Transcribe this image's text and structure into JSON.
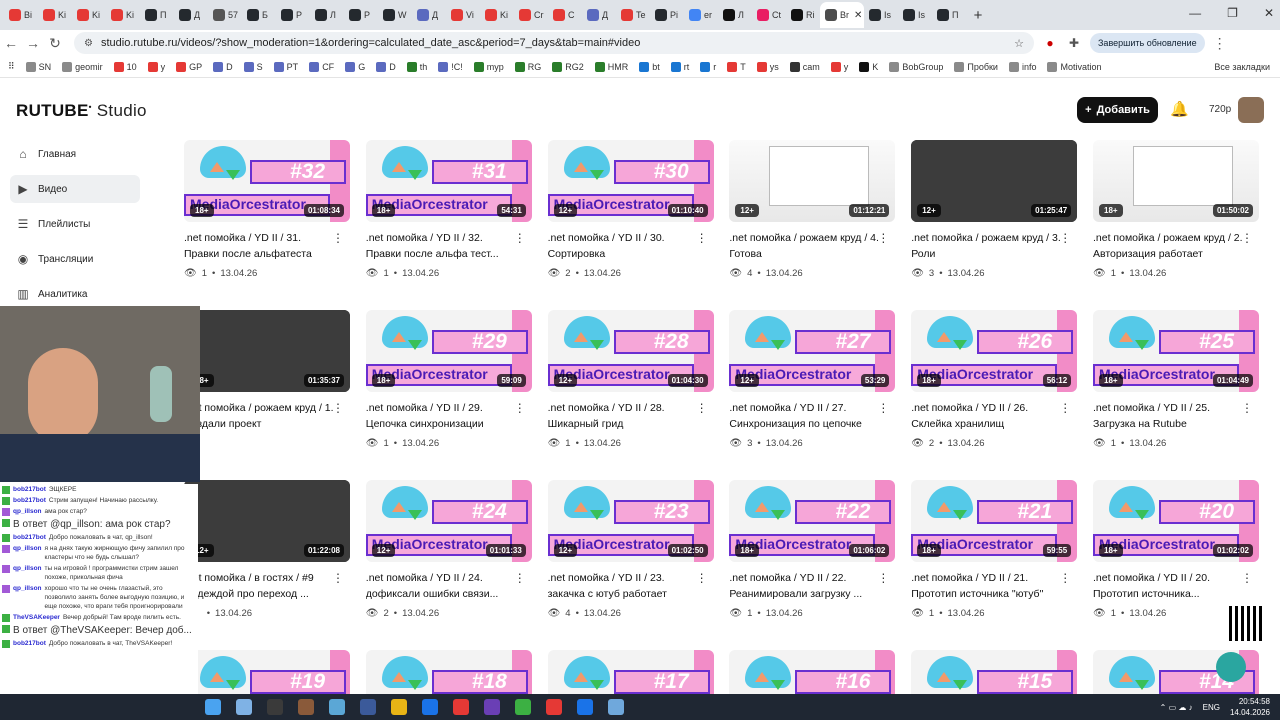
{
  "browser": {
    "tabs": [
      {
        "label": "Bi",
        "color": "#e53935"
      },
      {
        "label": "Ki",
        "color": "#e53935"
      },
      {
        "label": "Ki",
        "color": "#e53935"
      },
      {
        "label": "Ki",
        "color": "#e53935"
      },
      {
        "label": "П",
        "color": "#24292e"
      },
      {
        "label": "Д",
        "color": "#24292e"
      },
      {
        "label": "57",
        "color": "#555555"
      },
      {
        "label": "Б",
        "color": "#24292e"
      },
      {
        "label": "Р",
        "color": "#24292e"
      },
      {
        "label": "Л",
        "color": "#24292e"
      },
      {
        "label": "Р",
        "color": "#24292e"
      },
      {
        "label": "W",
        "color": "#24292e"
      },
      {
        "label": "Д",
        "color": "#5b6abf"
      },
      {
        "label": "Vi",
        "color": "#e53935"
      },
      {
        "label": "Ki",
        "color": "#e53935"
      },
      {
        "label": "Cr",
        "color": "#e53935"
      },
      {
        "label": "С",
        "color": "#e53935"
      },
      {
        "label": "Д",
        "color": "#5b6abf"
      },
      {
        "label": "Te",
        "color": "#e53935"
      },
      {
        "label": "Pi",
        "color": "#24292e"
      },
      {
        "label": "er",
        "color": "#4285f4"
      },
      {
        "label": "Л",
        "color": "#111111"
      },
      {
        "label": "Ct",
        "color": "#e91e63"
      },
      {
        "label": "Ri",
        "color": "#111111"
      },
      {
        "label": "Br",
        "color": "#4d4d4d",
        "active": true
      },
      {
        "label": "Is",
        "color": "#24292e"
      },
      {
        "label": "Is",
        "color": "#24292e"
      },
      {
        "label": "П",
        "color": "#24292e"
      }
    ],
    "url": "studio.rutube.ru/videos/?show_moderation=1&ordering=calculated_date_asc&period=7_days&tab=main#video",
    "update_label": "Завершить обновление",
    "bookmarks": [
      {
        "label": "SN",
        "color": "#8a8a8a"
      },
      {
        "label": "geomir",
        "color": "#8a8a8a"
      },
      {
        "label": "10",
        "color": "#e53935"
      },
      {
        "label": "y",
        "color": "#e53935"
      },
      {
        "label": "GP",
        "color": "#e53935"
      },
      {
        "label": "D",
        "color": "#5b6abf"
      },
      {
        "label": "S",
        "color": "#5b6abf"
      },
      {
        "label": "PT",
        "color": "#5b6abf"
      },
      {
        "label": "CF",
        "color": "#5b6abf"
      },
      {
        "label": "G",
        "color": "#5b6abf"
      },
      {
        "label": "D",
        "color": "#5b6abf"
      },
      {
        "label": "th",
        "color": "#2a7d2a"
      },
      {
        "label": "!C!",
        "color": "#5b6abf"
      },
      {
        "label": "myp",
        "color": "#2a7d2a"
      },
      {
        "label": "RG",
        "color": "#2a7d2a"
      },
      {
        "label": "RG2",
        "color": "#2a7d2a"
      },
      {
        "label": "HMR",
        "color": "#2a7d2a"
      },
      {
        "label": "bt",
        "color": "#1976d2"
      },
      {
        "label": "rt",
        "color": "#1976d2"
      },
      {
        "label": "r",
        "color": "#1976d2"
      },
      {
        "label": "T",
        "color": "#e53935"
      },
      {
        "label": "ys",
        "color": "#e53935"
      },
      {
        "label": "cam",
        "color": "#333333"
      },
      {
        "label": "y",
        "color": "#e53935"
      },
      {
        "label": "K",
        "color": "#111111"
      },
      {
        "label": "BobGroup",
        "color": "#8a8a8a"
      },
      {
        "label": "Пробки",
        "color": "#8a8a8a"
      },
      {
        "label": "info",
        "color": "#8a8a8a"
      },
      {
        "label": "Motivation",
        "color": "#8a8a8a"
      }
    ],
    "all_bookmarks": "Все закладки"
  },
  "header": {
    "logo_main": "RUTUBE",
    "logo_sub": "Studio",
    "add_label": "Добавить",
    "quality": "720p"
  },
  "sidebar": {
    "items": [
      {
        "label": "Главная",
        "icon": "home-icon",
        "glyph": "⌂"
      },
      {
        "label": "Видео",
        "icon": "video-icon",
        "glyph": "▶",
        "active": true
      },
      {
        "label": "Плейлисты",
        "icon": "playlist-icon",
        "glyph": "☰"
      },
      {
        "label": "Трансляции",
        "icon": "broadcast-icon",
        "glyph": "◉"
      },
      {
        "label": "Аналитика",
        "icon": "analytics-icon",
        "glyph": "▥"
      }
    ]
  },
  "videos": [
    {
      "title": ".net помойка / YD II / 31. Правки после альфатеста",
      "views": "1",
      "date": "13.04.26",
      "age": "18+",
      "duration": "01:08:34",
      "thumb": "media",
      "episode": "#32"
    },
    {
      "title": ".net помойка / YD II / 32. Правки после альфа тест...",
      "views": "1",
      "date": "13.04.26",
      "age": "18+",
      "duration": "54:31",
      "thumb": "media",
      "episode": "#31"
    },
    {
      "title": ".net помойка / YD II / 30. Сортировка",
      "views": "2",
      "date": "13.04.26",
      "age": "12+",
      "duration": "01:10:40",
      "thumb": "media",
      "episode": "#30"
    },
    {
      "title": ".net помойка / рожаем круд / 4. Готова",
      "views": "4",
      "date": "13.04.26",
      "age": "12+",
      "duration": "01:12:21",
      "thumb": "screen"
    },
    {
      "title": ".net помойка / рожаем круд / 3. Роли",
      "views": "3",
      "date": "13.04.26",
      "age": "12+",
      "duration": "01:25:47",
      "thumb": "dark"
    },
    {
      "title": ".net помойка / рожаем круд / 2. Авторизация работает",
      "views": "1",
      "date": "13.04.26",
      "age": "18+",
      "duration": "01:50:02",
      "thumb": "screen"
    },
    {
      "title": ".net помойка / рожаем круд / 1. Создали проект",
      "views": "",
      "date": "",
      "age": "18+",
      "duration": "01:35:37",
      "thumb": "dark"
    },
    {
      "title": ".net помойка / YD II / 29. Цепочка синхронизации",
      "views": "1",
      "date": "13.04.26",
      "age": "18+",
      "duration": "59:09",
      "thumb": "media",
      "episode": "#29"
    },
    {
      "title": ".net помойка / YD II / 28. Шикарный грид",
      "views": "1",
      "date": "13.04.26",
      "age": "12+",
      "duration": "01:04:30",
      "thumb": "media",
      "episode": "#28"
    },
    {
      "title": ".net помойка / YD II / 27. Синхронизация по цепочке",
      "views": "3",
      "date": "13.04.26",
      "age": "12+",
      "duration": "53:29",
      "thumb": "media",
      "episode": "#27"
    },
    {
      "title": ".net помойка / YD II / 26. Склейка хранилищ",
      "views": "2",
      "date": "13.04.26",
      "age": "18+",
      "duration": "56:12",
      "thumb": "media",
      "episode": "#26"
    },
    {
      "title": ".net помойка / YD II / 25. Загрузка на Rutube",
      "views": "1",
      "date": "13.04.26",
      "age": "18+",
      "duration": "01:04:49",
      "thumb": "media",
      "episode": "#25"
    },
    {
      "title": ".net помойка / в гостях / #9 Надеждой про переход ...",
      "views": "",
      "date": "13.04.26",
      "age": "12+",
      "duration": "01:22:08",
      "thumb": "dark"
    },
    {
      "title": ".net помойка / YD II / 24. дофиксали ошибки связи...",
      "views": "2",
      "date": "13.04.26",
      "age": "12+",
      "duration": "01:01:33",
      "thumb": "media",
      "episode": "#24"
    },
    {
      "title": ".net помойка / YD II / 23. закачка с ютуб работает",
      "views": "4",
      "date": "13.04.26",
      "age": "12+",
      "duration": "01:02:50",
      "thumb": "media",
      "episode": "#23"
    },
    {
      "title": ".net помойка / YD II / 22. Реанимировали загрузку ...",
      "views": "1",
      "date": "13.04.26",
      "age": "18+",
      "duration": "01:06:02",
      "thumb": "media",
      "episode": "#22"
    },
    {
      "title": ".net помойка / YD II / 21. Прототип источника \"ютуб\"",
      "views": "1",
      "date": "13.04.26",
      "age": "18+",
      "duration": "59:55",
      "thumb": "media",
      "episode": "#21"
    },
    {
      "title": ".net помойка / YD II / 20. Прототип источника...",
      "views": "1",
      "date": "13.04.26",
      "age": "18+",
      "duration": "01:02:02",
      "thumb": "media",
      "episode": "#20"
    },
    {
      "title": "",
      "views": "",
      "date": "",
      "age": "",
      "duration": "",
      "thumb": "media",
      "episode": "#19"
    },
    {
      "title": "",
      "views": "",
      "date": "",
      "age": "",
      "duration": "",
      "thumb": "media",
      "episode": "#18"
    },
    {
      "title": "",
      "views": "",
      "date": "",
      "age": "",
      "duration": "",
      "thumb": "media",
      "episode": "#17"
    },
    {
      "title": "",
      "views": "",
      "date": "",
      "age": "",
      "duration": "",
      "thumb": "media",
      "episode": "#16"
    },
    {
      "title": "",
      "views": "",
      "date": "",
      "age": "",
      "duration": "",
      "thumb": "media",
      "episode": "#15"
    },
    {
      "title": "",
      "views": "",
      "date": "",
      "age": "",
      "duration": "",
      "thumb": "media",
      "episode": "#14"
    }
  ],
  "thumb_brand": "MediaOrcestrator",
  "chat": [
    {
      "user": "bob217bot",
      "text": "ЭЩКЕРЕ"
    },
    {
      "user": "bob217bot",
      "text": "Стрим запущен! Начинаю рассылку."
    },
    {
      "user": "qp_illson",
      "text": "ама рок стар?"
    },
    {
      "user": "",
      "text": "В ответ @qp_illson: ама рок стар?",
      "big": true
    },
    {
      "user": "bob217bot",
      "text": "Добро пожаловать в чат, qp_illson!"
    },
    {
      "user": "qp_illson",
      "text": "я на днях такую жирнющую фичу запилил про кластеры что не будь слышал?"
    },
    {
      "user": "qp_illson",
      "text": "ты на игровой ! программистки стрим зашел похоже, прикольная фича"
    },
    {
      "user": "qp_illson",
      "text": "хорошо что ты не очень глазастый, это позволило занять более выгодную позицию, и еще похоже, что враги тебя проигнорировали"
    },
    {
      "user": "TheVSAKeeper",
      "text": "Вечер добрый! Там вроде пилить есть."
    },
    {
      "user": "",
      "text": "В ответ @TheVSAKeeper: Вечер доб...",
      "big": true
    },
    {
      "user": "bob217bot",
      "text": "Добро пожаловать в чат, TheVSAKeeper!"
    }
  ],
  "taskbar": {
    "lang": "ENG",
    "time": "20:54:58",
    "date": "14.04.2026",
    "apps": [
      "#7fb2e5",
      "#3a3a3a",
      "#8a5a3a",
      "#5ba7d6",
      "#3b5a9a",
      "#e7b416",
      "#1a73e8",
      "#e53935",
      "#6a3fb5",
      "#3cb043",
      "#e53935",
      "#1a73e8",
      "#6fa8dc"
    ]
  }
}
